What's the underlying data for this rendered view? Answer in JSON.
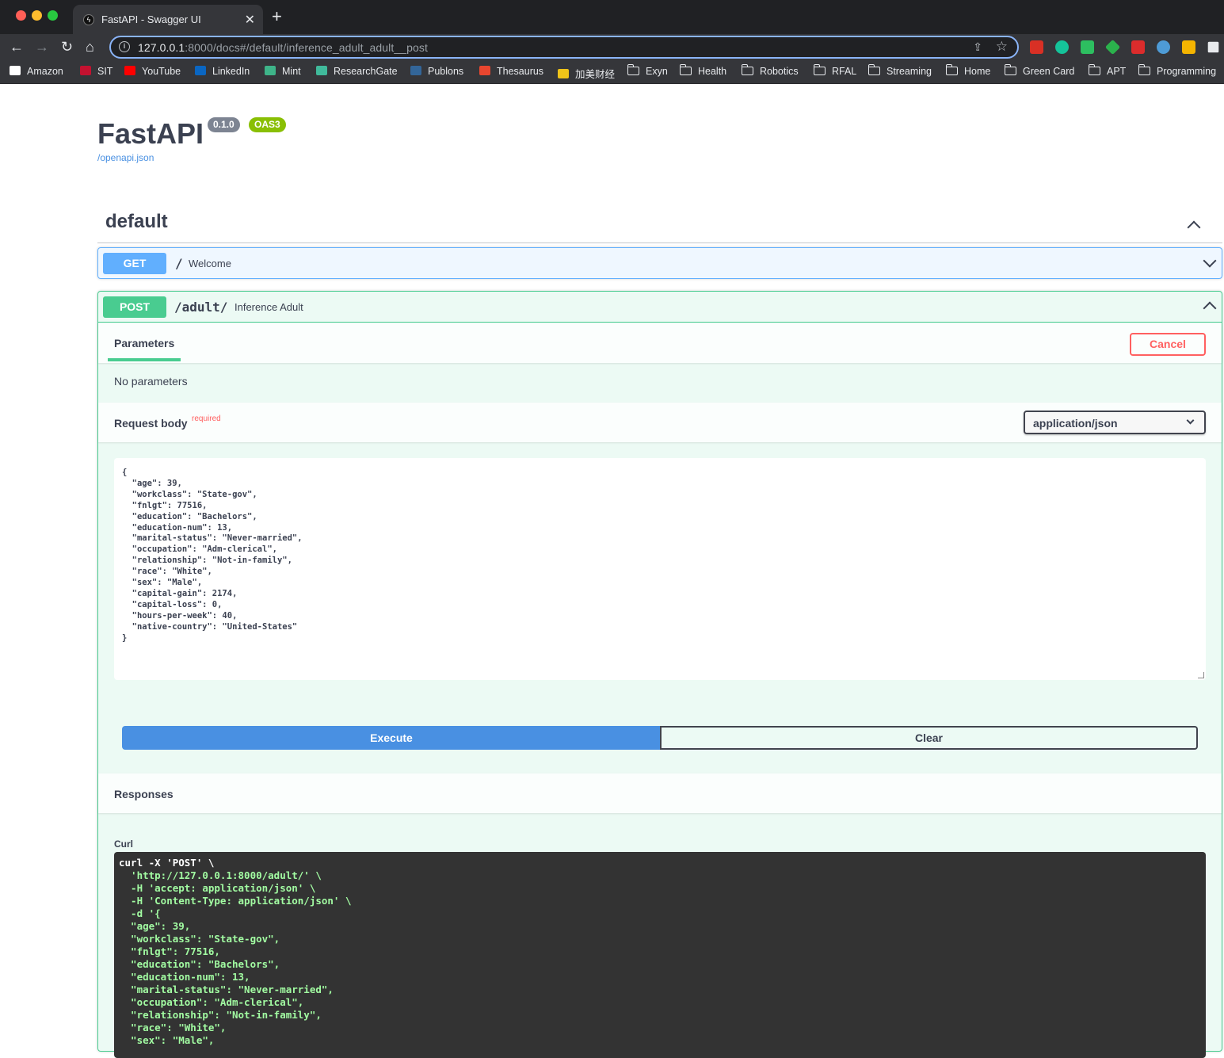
{
  "browser": {
    "tab_title": "FastAPI - Swagger UI",
    "url_host": "127.0.0.1",
    "url_rest": ":8000/docs#/default/inference_adult_adult__post",
    "bookmarks": [
      {
        "label": "Amazon",
        "icon": "amazon-icon",
        "color": "#ffffff"
      },
      {
        "label": "SIT",
        "icon": "sit-icon",
        "color": "#c41230"
      },
      {
        "label": "YouTube",
        "icon": "youtube-icon",
        "color": "#ff0000"
      },
      {
        "label": "LinkedIn",
        "icon": "linkedin-icon",
        "color": "#0a66c2"
      },
      {
        "label": "Mint",
        "icon": "mint-icon",
        "color": "#3eb489"
      },
      {
        "label": "ResearchGate",
        "icon": "researchgate-icon",
        "color": "#40ba9b"
      },
      {
        "label": "Publons",
        "icon": "publons-icon",
        "color": "#336699"
      },
      {
        "label": "Thesaurus",
        "icon": "thesaurus-icon",
        "color": "#e8462f"
      },
      {
        "label": "加美财经",
        "icon": "jiamei-icon",
        "color": "#f0c419"
      },
      {
        "label": "Exyn",
        "icon": "folder-icon"
      },
      {
        "label": "Health",
        "icon": "folder-icon"
      },
      {
        "label": "Robotics",
        "icon": "folder-icon"
      },
      {
        "label": "RFAL",
        "icon": "folder-icon"
      },
      {
        "label": "Streaming",
        "icon": "folder-icon"
      },
      {
        "label": "Home",
        "icon": "folder-icon"
      },
      {
        "label": "Green Card",
        "icon": "folder-icon"
      },
      {
        "label": "APT",
        "icon": "folder-icon"
      },
      {
        "label": "Programming",
        "icon": "folder-icon"
      }
    ]
  },
  "header": {
    "title": "FastAPI",
    "version_badge": "0.1.0",
    "oas_badge": "OAS3",
    "spec_link": "/openapi.json"
  },
  "tag": {
    "name": "default"
  },
  "operations": {
    "get": {
      "method": "GET",
      "path": "/",
      "summary": "Welcome"
    },
    "post": {
      "method": "POST",
      "path": "/adult/",
      "summary": "Inference Adult"
    }
  },
  "post_panel": {
    "parameters_tab": "Parameters",
    "cancel_label": "Cancel",
    "no_parameters": "No parameters",
    "request_body_label": "Request body",
    "required_label": "required",
    "content_type": "application/json",
    "request_body_json": "{\n  \"age\": 39,\n  \"workclass\": \"State-gov\",\n  \"fnlgt\": 77516,\n  \"education\": \"Bachelors\",\n  \"education-num\": 13,\n  \"marital-status\": \"Never-married\",\n  \"occupation\": \"Adm-clerical\",\n  \"relationship\": \"Not-in-family\",\n  \"race\": \"White\",\n  \"sex\": \"Male\",\n  \"capital-gain\": 2174,\n  \"capital-loss\": 0,\n  \"hours-per-week\": 40,\n  \"native-country\": \"United-States\"\n}",
    "execute_label": "Execute",
    "clear_label": "Clear",
    "responses_label": "Responses",
    "curl_label": "Curl",
    "curl_lines": [
      "curl -X 'POST' \\",
      "  'http://127.0.0.1:8000/adult/' \\",
      "  -H 'accept: application/json' \\",
      "  -H 'Content-Type: application/json' \\",
      "  -d '{",
      "  \"age\": 39,",
      "  \"workclass\": \"State-gov\",",
      "  \"fnlgt\": 77516,",
      "  \"education\": \"Bachelors\",",
      "  \"education-num\": 13,",
      "  \"marital-status\": \"Never-married\",",
      "  \"occupation\": \"Adm-clerical\",",
      "  \"relationship\": \"Not-in-family\",",
      "  \"race\": \"White\",",
      "  \"sex\": \"Male\","
    ]
  },
  "colors": {
    "get": "#61affe",
    "post": "#49cc90",
    "version_badge": "#7d8492",
    "oas_badge": "#89bf04",
    "execute": "#4990e2",
    "cancel": "#ff6060"
  }
}
